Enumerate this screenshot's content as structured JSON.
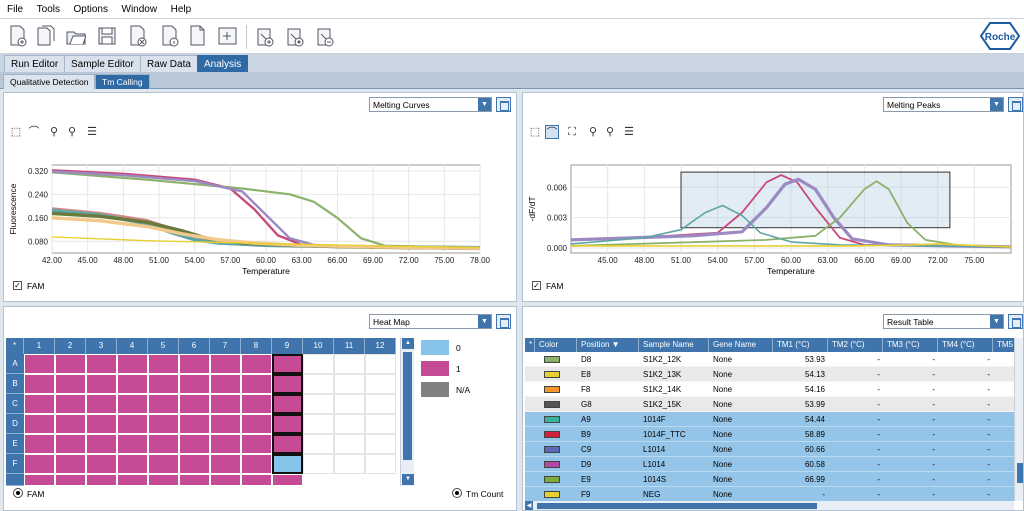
{
  "menu": [
    "File",
    "Tools",
    "Options",
    "Window",
    "Help"
  ],
  "logo": "Roche",
  "main_tabs": [
    "Run Editor",
    "Sample Editor",
    "Raw Data",
    "Analysis"
  ],
  "sub_tabs": [
    "Qualitative Detection",
    "Tm Calling"
  ],
  "left_chart": {
    "selector": "Melting Curves",
    "ylabel": "Fluorescence",
    "xlabel": "Temperature",
    "y_ticks": [
      "0.320",
      "0.240",
      "0.160",
      "0.080"
    ],
    "x_ticks": [
      "42.00",
      "45.00",
      "48.00",
      "51.00",
      "54.00",
      "57.00",
      "60.00",
      "63.00",
      "66.00",
      "69.00",
      "72.00",
      "75.00",
      "78.00"
    ],
    "channel": "FAM"
  },
  "right_chart": {
    "selector": "Melting Peaks",
    "ylabel": "-dF/dT",
    "xlabel": "Temperature",
    "y_ticks": [
      "0.006",
      "0.003",
      "0.000"
    ],
    "x_ticks": [
      "45.00",
      "48.00",
      "51.00",
      "54.00",
      "57.00",
      "60.00",
      "63.00",
      "66.00",
      "69.00",
      "72.00",
      "75.00"
    ],
    "channel": "FAM"
  },
  "chart_data": [
    {
      "type": "line",
      "xlabel": "Temperature",
      "ylabel": "Fluorescence",
      "xlim": [
        42,
        78
      ],
      "ylim": [
        0.04,
        0.34
      ],
      "series": [
        {
          "color": "#c94a7a",
          "x": [
            42,
            48,
            54,
            57,
            59,
            61,
            63,
            66,
            70,
            78
          ],
          "y": [
            0.322,
            0.31,
            0.29,
            0.26,
            0.19,
            0.1,
            0.068,
            0.062,
            0.058,
            0.054
          ]
        },
        {
          "color": "#8bb26a",
          "x": [
            42,
            50,
            58,
            62,
            64,
            66,
            68,
            70,
            78
          ],
          "y": [
            0.315,
            0.29,
            0.26,
            0.24,
            0.215,
            0.16,
            0.09,
            0.065,
            0.058
          ]
        },
        {
          "color": "#9b8ac2",
          "x": [
            42,
            48,
            54,
            58,
            60,
            62,
            64,
            68,
            78
          ],
          "y": [
            0.318,
            0.305,
            0.285,
            0.25,
            0.17,
            0.09,
            0.068,
            0.06,
            0.055
          ]
        },
        {
          "color": "#d08a8a",
          "x": [
            42,
            46,
            50,
            53,
            55,
            57,
            60,
            66,
            78
          ],
          "y": [
            0.19,
            0.175,
            0.15,
            0.11,
            0.085,
            0.074,
            0.068,
            0.062,
            0.058
          ]
        },
        {
          "color": "#5da6a6",
          "x": [
            42,
            46,
            50,
            52,
            54,
            56,
            60,
            66,
            78
          ],
          "y": [
            0.185,
            0.17,
            0.14,
            0.11,
            0.085,
            0.074,
            0.066,
            0.062,
            0.058
          ]
        },
        {
          "color": "#6a7a3a",
          "x": [
            42,
            46,
            50,
            53,
            55,
            58,
            62,
            68,
            78
          ],
          "y": [
            0.175,
            0.165,
            0.145,
            0.115,
            0.09,
            0.074,
            0.066,
            0.06,
            0.056
          ]
        },
        {
          "color": "#f2c98a",
          "x": [
            42,
            46,
            50,
            53,
            56,
            59,
            63,
            70,
            78
          ],
          "y": [
            0.16,
            0.15,
            0.13,
            0.105,
            0.085,
            0.074,
            0.066,
            0.06,
            0.056
          ]
        },
        {
          "color": "#e8d030",
          "x": [
            42,
            50,
            60,
            70,
            78
          ],
          "y": [
            0.095,
            0.082,
            0.072,
            0.064,
            0.058
          ]
        }
      ]
    },
    {
      "type": "line",
      "xlabel": "Temperature",
      "ylabel": "-dF/dT",
      "xlim": [
        42,
        78
      ],
      "ylim": [
        -0.0005,
        0.0082
      ],
      "series": [
        {
          "color": "#c94a7a",
          "x": [
            42,
            50,
            54,
            56,
            58,
            59.2,
            60.5,
            62,
            64,
            66,
            78
          ],
          "y": [
            0.0008,
            0.0012,
            0.0015,
            0.0035,
            0.0065,
            0.0072,
            0.0065,
            0.004,
            0.001,
            0.0003,
            0.0001
          ]
        },
        {
          "color": "#9b8ac2",
          "x": [
            42,
            52,
            56,
            58,
            59.5,
            60.6,
            62,
            63.5,
            65,
            68,
            78
          ],
          "y": [
            0.0008,
            0.0012,
            0.0016,
            0.004,
            0.0063,
            0.0068,
            0.0058,
            0.003,
            0.0009,
            0.0003,
            0.0001
          ]
        },
        {
          "color": "#8bb26a",
          "x": [
            42,
            58,
            62,
            64,
            66,
            67,
            68,
            69.5,
            71,
            74,
            78
          ],
          "y": [
            0.0002,
            0.0008,
            0.0012,
            0.003,
            0.0058,
            0.0066,
            0.0058,
            0.0025,
            0.0008,
            0.0002,
            0.0001
          ]
        },
        {
          "color": "#5da6a6",
          "x": [
            42,
            48,
            51,
            53,
            54.4,
            56,
            57.5,
            60,
            64,
            78
          ],
          "y": [
            0.0004,
            0.001,
            0.0018,
            0.0035,
            0.0042,
            0.0032,
            0.0015,
            0.0006,
            0.0003,
            0.0001
          ]
        },
        {
          "color": "#e8d030",
          "x": [
            42,
            55,
            60,
            65,
            70,
            72,
            74,
            78
          ],
          "y": [
            0.0002,
            0.0002,
            0.0002,
            0.0002,
            0.0003,
            0.0004,
            0.0003,
            0.0001
          ]
        }
      ]
    }
  ],
  "heatmap": {
    "selector": "Heat Map",
    "columns": [
      "1",
      "2",
      "3",
      "4",
      "5",
      "6",
      "7",
      "8",
      "9",
      "10",
      "11",
      "12"
    ],
    "rows": [
      "A",
      "B",
      "C",
      "D",
      "E",
      "F"
    ],
    "corner": "*",
    "legend": [
      {
        "label": "0",
        "color": "#87c4ea"
      },
      {
        "label": "1",
        "color": "#c64b94"
      },
      {
        "label": "N/A",
        "color": "#808080"
      }
    ],
    "channel_label": "FAM",
    "mode_label": "Tm Count"
  },
  "result_table": {
    "selector": "Result Table",
    "corner": "*",
    "headers": [
      "Color",
      "Position",
      "Sample Name",
      "Gene Name",
      "TM1 (°C)",
      "TM2 (°C)",
      "TM3 (°C)",
      "TM4 (°C)",
      "TM5"
    ],
    "rows": [
      {
        "color": "#8bb26a",
        "position": "D8",
        "sample": "S1K2_12K",
        "gene": "None",
        "tm1": "53.93",
        "tm2": "-",
        "tm3": "-",
        "tm4": "-",
        "selected": false
      },
      {
        "color": "#e8d030",
        "position": "E8",
        "sample": "S1K2_13K",
        "gene": "None",
        "tm1": "54.13",
        "tm2": "-",
        "tm3": "-",
        "tm4": "-",
        "selected": false
      },
      {
        "color": "#f2952a",
        "position": "F8",
        "sample": "S1K2_14K",
        "gene": "None",
        "tm1": "54.16",
        "tm2": "-",
        "tm3": "-",
        "tm4": "-",
        "selected": false
      },
      {
        "color": "#555555",
        "position": "G8",
        "sample": "S1K2_15K",
        "gene": "None",
        "tm1": "53.99",
        "tm2": "-",
        "tm3": "-",
        "tm4": "-",
        "selected": false
      },
      {
        "color": "#3ab29a",
        "position": "A9",
        "sample": "1014F",
        "gene": "None",
        "tm1": "54.44",
        "tm2": "-",
        "tm3": "-",
        "tm4": "-",
        "selected": true
      },
      {
        "color": "#d0203a",
        "position": "B9",
        "sample": "1014F_TTC",
        "gene": "None",
        "tm1": "58.89",
        "tm2": "-",
        "tm3": "-",
        "tm4": "-",
        "selected": true
      },
      {
        "color": "#5a6ab8",
        "position": "C9",
        "sample": "L1014",
        "gene": "None",
        "tm1": "60.66",
        "tm2": "-",
        "tm3": "-",
        "tm4": "-",
        "selected": true
      },
      {
        "color": "#b04aa0",
        "position": "D9",
        "sample": "L1014",
        "gene": "None",
        "tm1": "60.58",
        "tm2": "-",
        "tm3": "-",
        "tm4": "-",
        "selected": true
      },
      {
        "color": "#7aac3a",
        "position": "E9",
        "sample": "1014S",
        "gene": "None",
        "tm1": "66.99",
        "tm2": "-",
        "tm3": "-",
        "tm4": "-",
        "selected": true
      },
      {
        "color": "#e8d030",
        "position": "F9",
        "sample": "NEG",
        "gene": "None",
        "tm1": "-",
        "tm2": "-",
        "tm3": "-",
        "tm4": "-",
        "selected": true
      }
    ]
  }
}
